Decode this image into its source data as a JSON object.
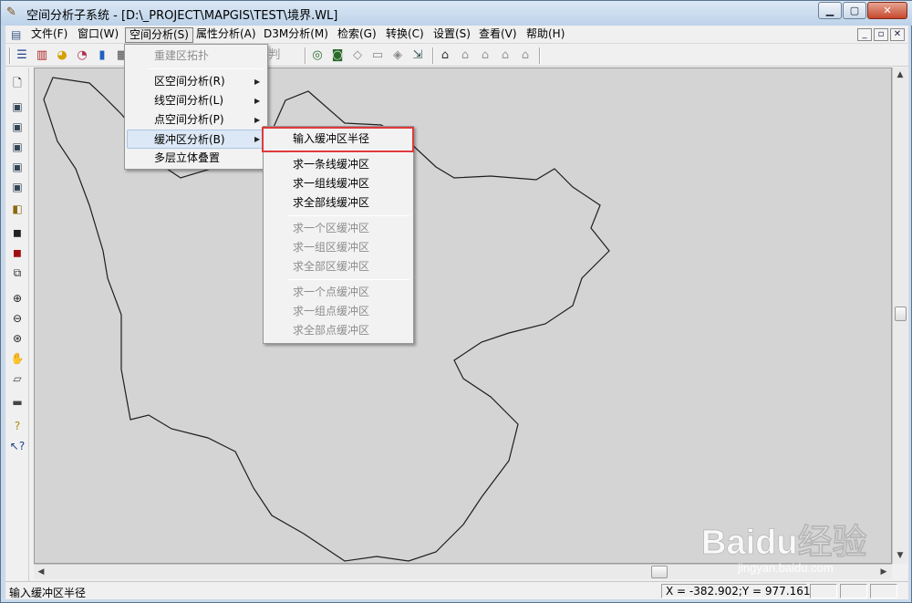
{
  "window": {
    "title": "空间分析子系统 - [D:\\_PROJECT\\MAPGIS\\TEST\\境界.WL]",
    "controls": {
      "minimize": "▁",
      "maximize": "▢",
      "close": "✕"
    }
  },
  "menubar": {
    "items": [
      "文件(F)",
      "窗口(W)",
      "空间分析(S)",
      "属性分析(A)",
      "D3M分析(M)",
      "检索(G)",
      "转换(C)",
      "设置(S)",
      "查看(V)",
      "帮助(H)"
    ],
    "active_index": 2,
    "mdi_controls": [
      "_",
      "▫",
      "✕"
    ]
  },
  "toolbar": {
    "icons": [
      "align-left-icon",
      "bar-chart-icon",
      "pie-chart-icon",
      "pie-3d-icon",
      "column-chart-icon",
      "table-icon",
      "area-chart-icon",
      "dashed-chart-icon",
      "text-icon",
      "judge-icon",
      "map-icon-1",
      "map-icon-2",
      "eraser-icon",
      "window-icon",
      "layers-icon",
      "export-icon",
      "node-icon-1",
      "node-icon-2",
      "node-icon-3",
      "node-icon-4",
      "node-icon-5"
    ],
    "partial_text": "判"
  },
  "left_toolbar": {
    "icons": [
      "new-document-icon",
      "layer-icon-1",
      "layer-icon-2",
      "layer-icon-3",
      "layer-icon-4",
      "layer-icon-5",
      "clip-icon",
      "save-icon",
      "save-as-icon",
      "copy-icon",
      "zoom-in-icon",
      "zoom-out-icon",
      "zoom-window-icon",
      "pan-icon",
      "eraser-icon",
      "ruler-icon",
      "help-icon",
      "context-help-icon"
    ]
  },
  "spatial_menu": {
    "items": [
      {
        "label": "重建区拓扑",
        "disabled": true,
        "submenu": false
      },
      {
        "label": "区空间分析(R)",
        "disabled": false,
        "submenu": true
      },
      {
        "label": "线空间分析(L)",
        "disabled": false,
        "submenu": true
      },
      {
        "label": "点空间分析(P)",
        "disabled": false,
        "submenu": true
      },
      {
        "label": "缓冲区分析(B)",
        "disabled": false,
        "submenu": true,
        "highlighted": true
      },
      {
        "label": "多层立体叠置",
        "disabled": false,
        "submenu": false
      }
    ]
  },
  "buffer_submenu": {
    "items": [
      {
        "label": "输入缓冲区半径",
        "disabled": false,
        "highlighted": true
      },
      {
        "label": "求一条线缓冲区",
        "disabled": false
      },
      {
        "label": "求一组线缓冲区",
        "disabled": false
      },
      {
        "label": "求全部线缓冲区",
        "disabled": false
      },
      {
        "label": "求一个区缓冲区",
        "disabled": true
      },
      {
        "label": "求一组区缓冲区",
        "disabled": true
      },
      {
        "label": "求全部区缓冲区",
        "disabled": true
      },
      {
        "label": "求一个点缓冲区",
        "disabled": true
      },
      {
        "label": "求一组点缓冲区",
        "disabled": true
      },
      {
        "label": "求全部点缓冲区",
        "disabled": true
      }
    ]
  },
  "statusbar": {
    "message": "输入缓冲区半径",
    "coordinates": "X = -382.902;Y = 977.161"
  },
  "watermark": {
    "brand": "Baidu经验",
    "url": "jingyan.baidu.com"
  },
  "colors": {
    "map_background": "#d4d4d4",
    "highlight_box": "#e0393a",
    "menu_hover": "#dce8f6"
  }
}
